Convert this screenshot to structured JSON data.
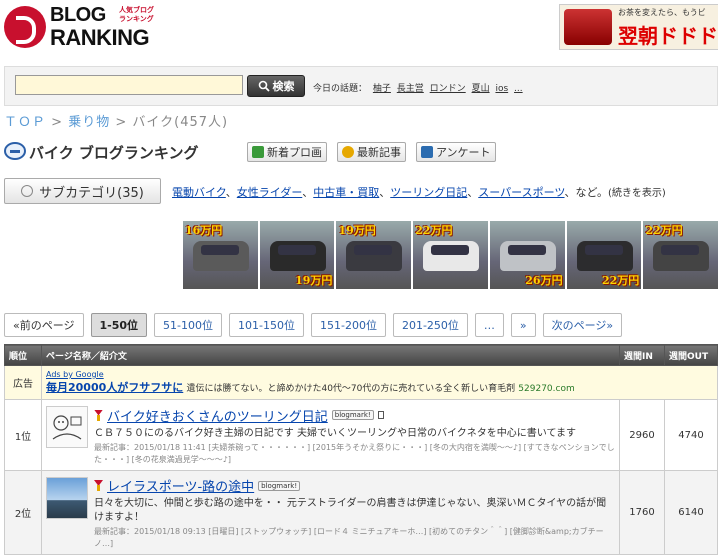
{
  "logo": {
    "line1": "BLOG",
    "line2": "RANKING",
    "tagline1": "人気ブログ",
    "tagline2": "ランキング"
  },
  "header_ad": {
    "line1": "お茶を変えたら、もうビ",
    "line2": "翌朝ドドド"
  },
  "search": {
    "input_value": "",
    "button_label": "検索",
    "topics_label": "今日の話題：",
    "topics": [
      "柚子",
      "長主営",
      "ロンドン",
      "夏山",
      "ios",
      "..."
    ]
  },
  "breadcrumb": {
    "top": "ＴＯＰ",
    "sep": " > ",
    "cat1": "乗り物",
    "current": "バイク",
    "count": "(457人)"
  },
  "title": {
    "text": "バイク ブログランキング",
    "btn_new_pro": "新着プロ画",
    "btn_latest": "最新記事",
    "btn_survey": "アンケート"
  },
  "subcategory": {
    "button_label": "サブカテゴリ(35)",
    "links": [
      "電動バイク",
      "女性ライダー",
      "中古車・買取",
      "ツーリング日記",
      "スーパースポーツ"
    ],
    "suffix": "など。",
    "more": "(続きを表示)"
  },
  "car_ads": [
    {
      "top_price": "16万円",
      "bottom_price": "",
      "color": "#5a5a5a"
    },
    {
      "top_price": "",
      "bottom_price": "19万円",
      "color": "#2a2a2a"
    },
    {
      "top_price": "19万円",
      "bottom_price": "",
      "color": "#3a3a40"
    },
    {
      "top_price": "22万円",
      "bottom_price": "",
      "color": "#e8e8e8"
    },
    {
      "top_price": "",
      "bottom_price": "26万円",
      "color": "#bfc2c6"
    },
    {
      "top_price": "",
      "bottom_price": "22万円",
      "color": "#2c2c2e"
    },
    {
      "top_price": "22万円",
      "bottom_price": "",
      "color": "#444"
    }
  ],
  "pager": {
    "prev": "«前のページ",
    "pages": [
      "1-50位",
      "51-100位",
      "101-150位",
      "151-200位",
      "201-250位"
    ],
    "ellipsis": "…",
    "next_arrow": "»",
    "next": "次のページ»"
  },
  "table": {
    "headers": {
      "rank": "順位",
      "name": "ページ名称／紹介文",
      "in": "週間IN",
      "out": "週間OUT"
    },
    "ad_row": {
      "label": "広告",
      "by": "Ads by Google",
      "title": "毎月20000人がフサフサに",
      "desc": "遺伝には勝てない。と諦めかけた40代〜70代の方に売れている全く新しい育毛剤",
      "url": "529270.com"
    },
    "rows": [
      {
        "rank": "1位",
        "title": "バイク好きおくさんのツーリング日記",
        "badge": "blogmark!",
        "desc": "ＣＢ７５０にのるバイク好き主婦の日記です 夫婦でいくツーリングや日常のバイクネタを中心に書いてます",
        "recent": "最新記事：2015/01/18 11:41 [夫婦茶碗って・・・・・・] [2015年うそかえ祭りに・・・] [冬の大内宿を満喫〜〜♪] [すてきなペンションでした・・・] [冬の花泉満過見学〜〜〜♪]",
        "in": "2960",
        "out": "4740"
      },
      {
        "rank": "2位",
        "title": "レイラスポーツ-路の途中",
        "badge": "blogmark!",
        "desc": "日々を大切に、仲間と歩む路の途中を・・ 元テストライダーの肩書きは伊達じゃない、奥深いＭＣタイヤの話が聞けますよ！",
        "recent": "最新記事：2015/01/18 09:13 [日曜日] [ストップウォッチ] [ロード４ ミニチュアキーホ…] [初めてのチタン＾＾] [健脚診断&amp;カブチーノ…]",
        "in": "1760",
        "out": "6140"
      }
    ]
  }
}
